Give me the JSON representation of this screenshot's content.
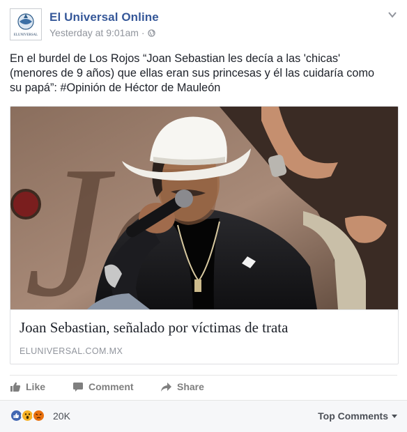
{
  "post": {
    "page_name": "El Universal Online",
    "timestamp": "Yesterday at 9:01am",
    "separator": "·",
    "avatar_text": "ELUNIVERSAL",
    "text": "En el burdel de Los Rojos “Joan Sebastian les decía a las 'chicas'\n(menores de 9 años) que ellas eran sus princesas y él las cuidaría como\nsu papá”: #Opinión de Héctor de Mauleón",
    "link": {
      "headline": "Joan Sebastian, señalado por víctimas de trata",
      "domain": "ELUNIVERSAL.COM.MX",
      "photo_bg_lettering": "Jo"
    }
  },
  "actions": {
    "like": "Like",
    "comment": "Comment",
    "share": "Share"
  },
  "reactions": {
    "count": "20K",
    "types": [
      "like",
      "wow",
      "angry"
    ],
    "sort_label": "Top Comments"
  },
  "colors": {
    "link_blue": "#365899",
    "meta_gray": "#90949c",
    "like_blue": "#4267b2",
    "wow_yellow": "#f7b125",
    "angry_orange": "#e9710f"
  }
}
